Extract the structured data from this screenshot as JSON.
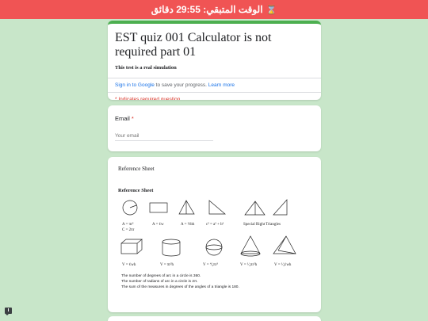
{
  "timer": {
    "text": "الوقت المتبقي: 29:55 دقائق",
    "icon": "hourglass-icon"
  },
  "header": {
    "title": "EST quiz 001 Calculator is not required part 01",
    "description": "This test is a real simulation",
    "signin_link": "Sign in to Google",
    "signin_text": " to save your progress. ",
    "learn_more": "Learn more",
    "required_note": "* Indicates required question"
  },
  "email": {
    "label": "Email",
    "required_mark": "*",
    "placeholder": "Your email"
  },
  "reference": {
    "label": "Reference Sheet",
    "image_heading": "Reference Sheet",
    "formulas": {
      "circle": [
        "A = πr²",
        "C = 2πr"
      ],
      "rectangle": "A = ℓw",
      "triangle": "A = ½bh",
      "pythagorean": "c² = a² + b²",
      "special_triangles": "Special Right Triangles",
      "box": "V = ℓwh",
      "cylinder": "V = πr²h",
      "sphere": "V = ⁴⁄₃πr³",
      "cone": "V = ¹⁄₃πr²h",
      "pyramid": "V = ¹⁄₃ℓwh"
    },
    "facts": [
      "The number of degrees of arc in a circle is 360.",
      "The number of radians of arc in a circle is 2π.",
      "The sum of the measures in degrees of the angles of a triangle is 180."
    ]
  },
  "colors": {
    "timer_bg": "#f05454",
    "page_bg": "#c8e6c9",
    "header_accent": "#4caf50",
    "link": "#1a73e8",
    "required": "#d93025"
  },
  "feedback": {
    "icon": "feedback-icon"
  }
}
